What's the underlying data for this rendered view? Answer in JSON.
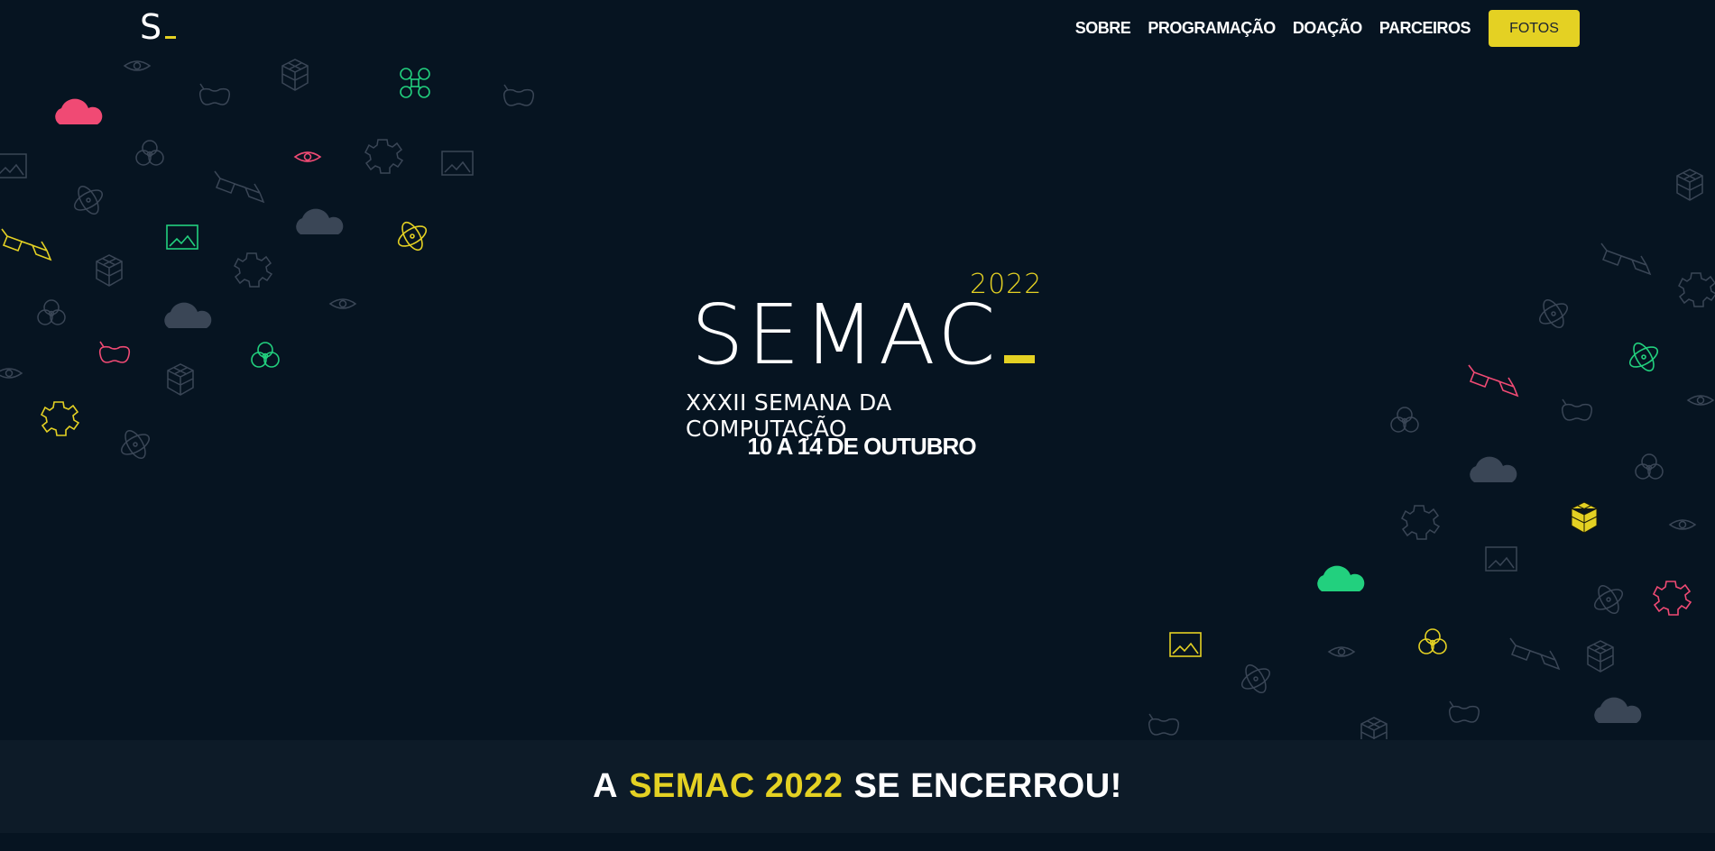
{
  "nav": {
    "logo_letter": "S",
    "items": [
      "SOBRE",
      "PROGRAMAÇÃO",
      "DOAÇÃO",
      "PARCEIROS"
    ],
    "cta": "FOTOS"
  },
  "hero": {
    "year": "2022",
    "title": "SEMAC",
    "subtitle": "XXXII SEMANA DA COMPUTAÇÃO",
    "dates": "10 A 14 DE OUTUBRO"
  },
  "banner": {
    "prefix": "A",
    "highlight": "SEMAC 2022",
    "suffix": "SE ENCERROU!"
  },
  "colors": {
    "background": "#061421",
    "accent": "#e4d123",
    "pink": "#f04a74",
    "green": "#22d07e",
    "muted": "#3a4656",
    "banner_bg": "#0d1b28"
  },
  "decor_icons": [
    "eye-icon",
    "cloud-icon",
    "cube-icon",
    "drone-icon",
    "glasses-icon",
    "gear-icon",
    "image-icon",
    "atom-icon",
    "vr-headset-icon",
    "flower-icon"
  ]
}
